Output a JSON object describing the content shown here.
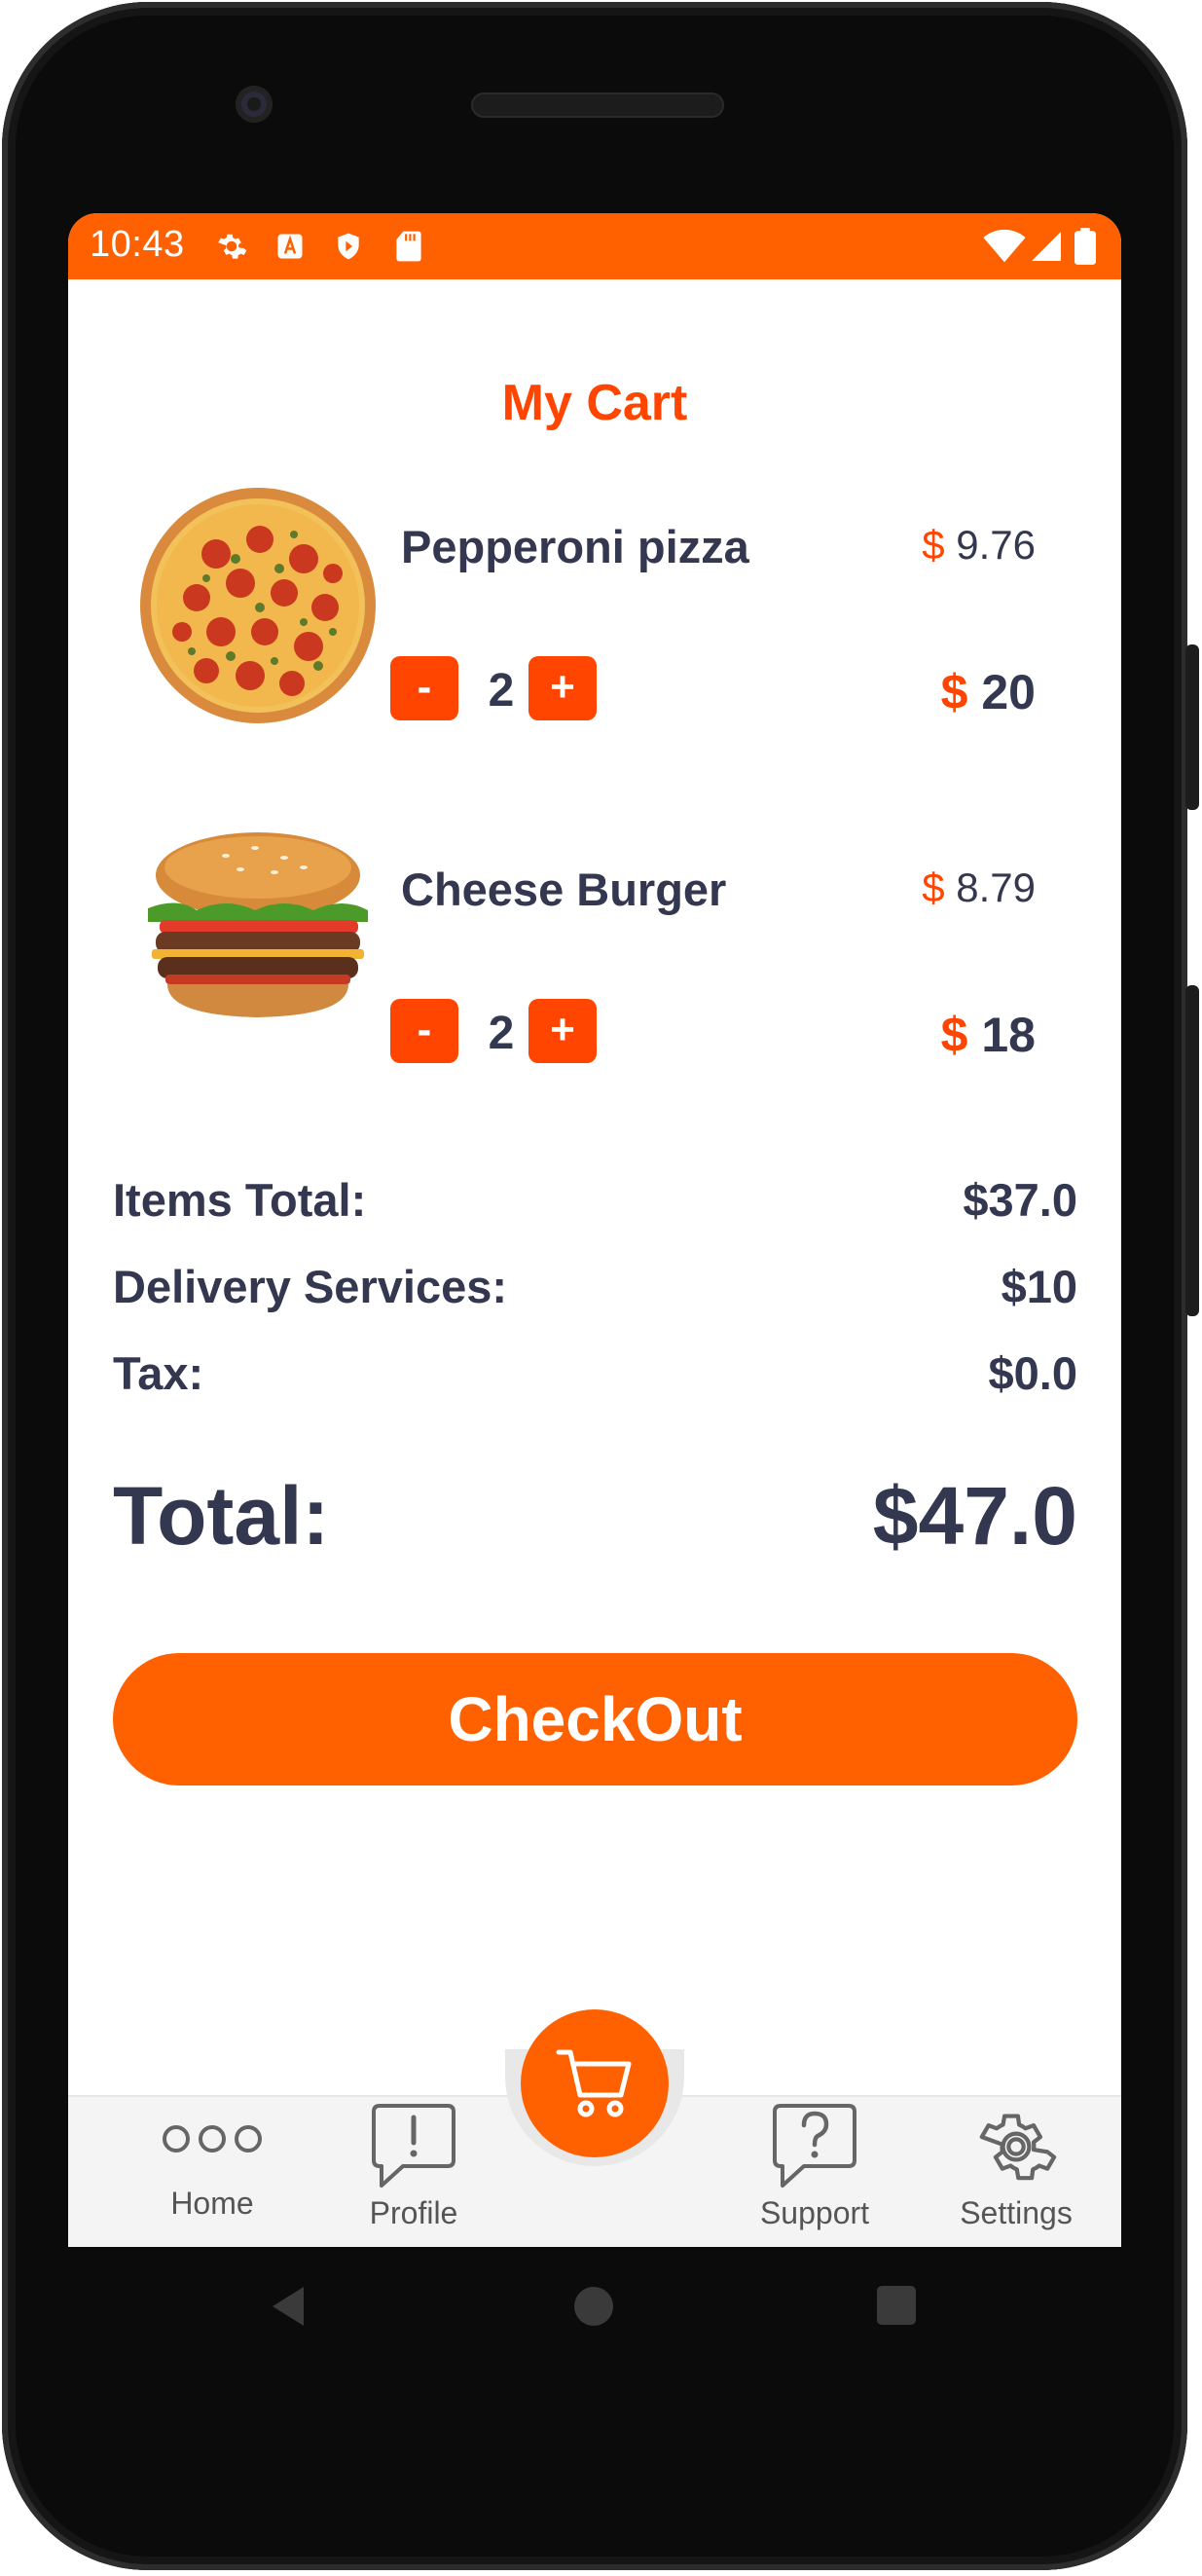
{
  "status_bar": {
    "time": "10:43"
  },
  "page": {
    "title": "My Cart"
  },
  "cart": {
    "currency_symbol": "$",
    "items": [
      {
        "name": "Pepperoni pizza",
        "unit_price": "9.76",
        "quantity": "2",
        "line_total": "20",
        "image": "pepperoni-pizza"
      },
      {
        "name": "Cheese Burger",
        "unit_price": "8.79",
        "quantity": "2",
        "line_total": "18",
        "image": "cheese-burger"
      }
    ],
    "minus_label": "-",
    "plus_label": "+"
  },
  "summary": {
    "items_total_label": "Items Total:",
    "items_total_value": "$37.0",
    "delivery_label": "Delivery Services:",
    "delivery_value": "$10",
    "tax_label": "Tax:",
    "tax_value": "$0.0",
    "total_label": "Total:",
    "total_value": "$47.0"
  },
  "checkout_label": "CheckOut",
  "bottom_nav": {
    "items": [
      {
        "label": "Home",
        "icon": "dots-icon"
      },
      {
        "label": "Profile",
        "icon": "alert-bubble-icon"
      },
      {
        "label": "Support",
        "icon": "question-bubble-icon"
      },
      {
        "label": "Settings",
        "icon": "gear-icon"
      }
    ],
    "center_icon": "cart-icon"
  },
  "colors": {
    "accent": "#ff6000",
    "accent_dark": "#ff4500",
    "text": "#333850"
  }
}
